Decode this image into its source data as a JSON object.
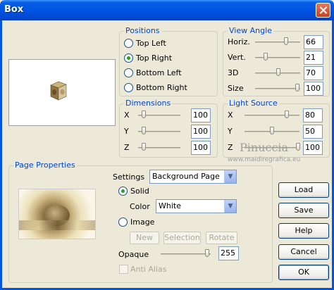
{
  "window": {
    "title": "Box"
  },
  "positions": {
    "legend": "Positions",
    "options": [
      "Top Left",
      "Top Right",
      "Bottom Left",
      "Bottom Right"
    ],
    "selected": "Top Right"
  },
  "view_angle": {
    "legend": "View Angle",
    "rows": [
      {
        "label": "Horiz.",
        "value": "66"
      },
      {
        "label": "Vert.",
        "value": "21"
      },
      {
        "label": "3D",
        "value": "70"
      },
      {
        "label": "Size",
        "value": "100"
      }
    ]
  },
  "dimensions": {
    "legend": "Dimensions",
    "rows": [
      {
        "label": "X",
        "value": "100"
      },
      {
        "label": "Y",
        "value": "100"
      },
      {
        "label": "Z",
        "value": "100"
      }
    ]
  },
  "light_source": {
    "legend": "Light Source",
    "rows": [
      {
        "label": "X",
        "value": "80"
      },
      {
        "label": "Y",
        "value": "50"
      },
      {
        "label": "Z",
        "value": "100"
      }
    ]
  },
  "page_properties": {
    "legend": "Page Properties",
    "settings_label": "Settings",
    "settings_value": "Background Page",
    "solid_label": "Solid",
    "color_label": "Color",
    "color_value": "White",
    "image_label": "Image",
    "new_label": "New",
    "selection_label": "Selection",
    "rotate_label": "Rotate",
    "opaque_label": "Opaque",
    "opaque_value": "255",
    "anti_alias_label": "Anti Alias"
  },
  "buttons": {
    "load": "Load",
    "save": "Save",
    "help": "Help",
    "cancel": "Cancel",
    "ok": "OK"
  },
  "watermark": {
    "name": "Pinuccia",
    "url": "www.maidiregrafica.eu"
  },
  "colors": {
    "accent": "#0054e3",
    "legend": "#0046d5",
    "radio_dot": "#21a121"
  }
}
